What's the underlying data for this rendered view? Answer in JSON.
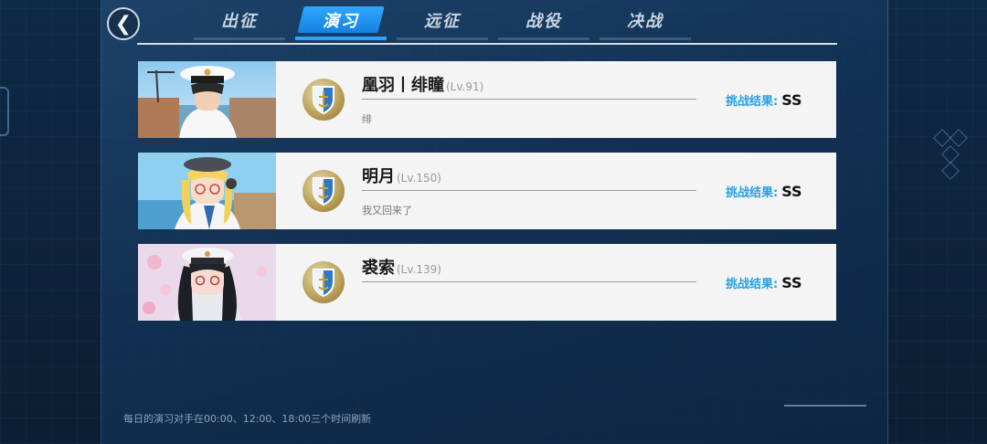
{
  "nav": {
    "back_symbol": "❮",
    "tabs": [
      {
        "label": "出征",
        "active": false
      },
      {
        "label": "演习",
        "active": true
      },
      {
        "label": "远征",
        "active": false
      },
      {
        "label": "战役",
        "active": false
      },
      {
        "label": "决战",
        "active": false
      }
    ]
  },
  "colors": {
    "accent": "#2aa4ff",
    "result_label": "#28a0e0",
    "row_bg": "#f4f4f4"
  },
  "opponents": [
    {
      "name": "凰羽丨绯瞳",
      "level": "(Lv.91)",
      "signature": "绯",
      "result_label": "挑战结果:",
      "result_grade": "SS"
    },
    {
      "name": "明月",
      "level": "(Lv.150)",
      "signature": "我又回来了",
      "result_label": "挑战结果:",
      "result_grade": "SS"
    },
    {
      "name": "裘索",
      "level": "(Lv.139)",
      "signature": "",
      "result_label": "挑战结果:",
      "result_grade": "SS"
    }
  ],
  "icons": {
    "medal": "anchor-shield-medal-icon",
    "back": "chevron-left-icon"
  },
  "footer": {
    "refresh_note": "每日的演习对手在00:00、12:00、18:00三个时间刷新"
  }
}
